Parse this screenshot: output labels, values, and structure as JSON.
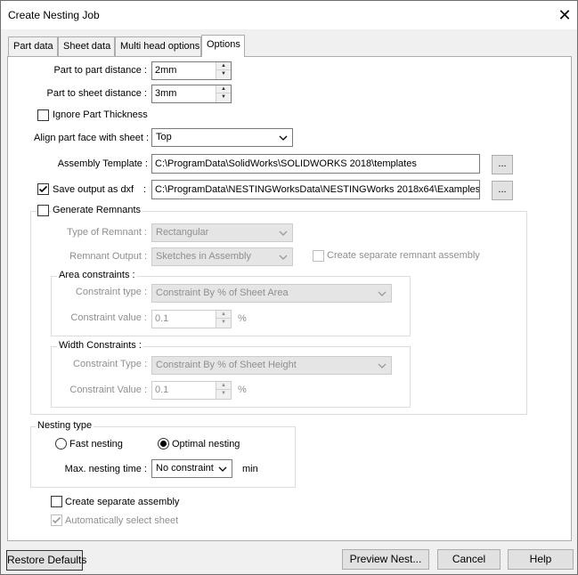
{
  "window": {
    "title": "Create Nesting Job",
    "close_glyph": "✕"
  },
  "tabs": [
    {
      "label": "Part data"
    },
    {
      "label": "Sheet data"
    },
    {
      "label": "Multi head options"
    },
    {
      "label": "Options",
      "active": true
    }
  ],
  "options": {
    "part_to_part": {
      "label": "Part to part distance :",
      "value": "2mm"
    },
    "part_to_sheet": {
      "label": "Part to sheet distance :",
      "value": "3mm"
    },
    "ignore_thickness": {
      "label": "Ignore Part Thickness",
      "checked": false
    },
    "align_face": {
      "label": "Align part face with sheet :",
      "value": "Top"
    },
    "assembly_template": {
      "label": "Assembly Template :",
      "value": "C:\\ProgramData\\SolidWorks\\SOLIDWORKS 2018\\templates",
      "browse": "..."
    },
    "save_dxf": {
      "label": "Save output as dxf",
      "colon": ":",
      "checked": true,
      "value": "C:\\ProgramData\\NESTINGWorksData\\NESTINGWorks 2018x64\\Examples",
      "browse": "..."
    },
    "remnants": {
      "label": "Generate Remnants",
      "checked": false,
      "type_label": "Type of Remnant :",
      "type_value": "Rectangular",
      "output_label": "Remnant Output :",
      "output_value": "Sketches in Assembly",
      "separate_label": "Create separate remnant assembly",
      "separate_checked": false,
      "area": {
        "title": "Area constraints :",
        "type_label": "Constraint type :",
        "type_value": "Constraint By % of Sheet Area",
        "value_label": "Constraint value :",
        "value": "0.1",
        "unit": "%"
      },
      "width": {
        "title": "Width Constraints :",
        "type_label": "Constraint Type :",
        "type_value": "Constraint By % of Sheet Height",
        "value_label": "Constraint Value :",
        "value": "0.1",
        "unit": "%"
      }
    },
    "nesting_type": {
      "title": "Nesting type",
      "fast_label": "Fast nesting",
      "optimal_label": "Optimal nesting",
      "selected": "optimal",
      "max_time_label": "Max. nesting time :",
      "max_time_value": "No constraint",
      "max_time_unit": "min"
    },
    "create_separate": {
      "label": "Create separate assembly",
      "checked": false
    },
    "auto_select_sheet": {
      "label": "Automatically select sheet",
      "checked": true
    }
  },
  "footer": {
    "restore": "Restore Defaults",
    "preview": "Preview Nest...",
    "cancel": "Cancel",
    "help": "Help"
  }
}
